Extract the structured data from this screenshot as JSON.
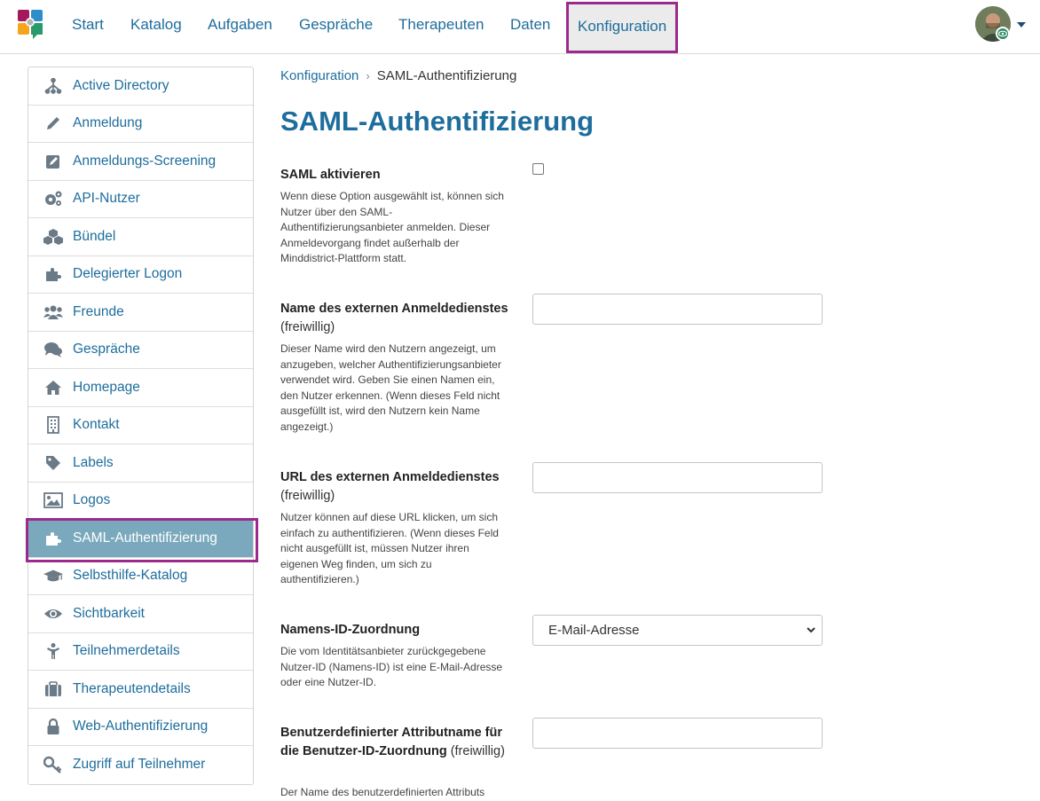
{
  "colors": {
    "primary": "#1e6d9c",
    "active_border": "#9c2a8c",
    "sidebar_active_bg": "#7aa9bd"
  },
  "nav": {
    "items": [
      {
        "label": "Start"
      },
      {
        "label": "Katalog"
      },
      {
        "label": "Aufgaben"
      },
      {
        "label": "Gespräche"
      },
      {
        "label": "Therapeuten"
      },
      {
        "label": "Daten"
      },
      {
        "label": "Konfiguration",
        "active": true
      }
    ]
  },
  "sidebar": {
    "items": [
      {
        "label": "Active Directory",
        "icon": "sitemap-icon"
      },
      {
        "label": "Anmeldung",
        "icon": "pencil-icon"
      },
      {
        "label": "Anmeldungs-Screening",
        "icon": "edit-square-icon"
      },
      {
        "label": "API-Nutzer",
        "icon": "gears-icon"
      },
      {
        "label": "Bündel",
        "icon": "cubes-icon"
      },
      {
        "label": "Delegierter Logon",
        "icon": "puzzle-icon"
      },
      {
        "label": "Freunde",
        "icon": "users-icon"
      },
      {
        "label": "Gespräche",
        "icon": "comments-icon"
      },
      {
        "label": "Homepage",
        "icon": "home-icon"
      },
      {
        "label": "Kontakt",
        "icon": "building-icon"
      },
      {
        "label": "Labels",
        "icon": "tag-icon"
      },
      {
        "label": "Logos",
        "icon": "image-icon"
      },
      {
        "label": "SAML-Authentifizierung",
        "icon": "puzzle-icon",
        "active": true
      },
      {
        "label": "Selbsthilfe-Katalog",
        "icon": "graduation-cap-icon"
      },
      {
        "label": "Sichtbarkeit",
        "icon": "eye-icon"
      },
      {
        "label": "Teilnehmerdetails",
        "icon": "child-icon"
      },
      {
        "label": "Therapeutendetails",
        "icon": "suitcase-icon"
      },
      {
        "label": "Web-Authentifizierung",
        "icon": "lock-icon"
      },
      {
        "label": "Zugriff auf Teilnehmer",
        "icon": "key-icon"
      }
    ]
  },
  "breadcrumb": {
    "parent": "Konfiguration",
    "separator": "›",
    "current": "SAML-Authentifizierung"
  },
  "page": {
    "title": "SAML-Authentifizierung"
  },
  "form": {
    "saml_enable": {
      "label": "SAML aktivieren",
      "help": "Wenn diese Option ausgewählt ist, können sich Nutzer über den SAML-Authentifizierungsanbieter anmelden. Dieser Anmeldevorgang findet außerhalb der Minddistrict-Plattform statt.",
      "checked": false
    },
    "service_name": {
      "label": "Name des externen Anmeldedienstes",
      "optional": "(freiwillig)",
      "help": "Dieser Name wird den Nutzern angezeigt, um anzugeben, welcher Authentifizierungsanbieter verwendet wird. Geben Sie einen Namen ein, den Nutzer erkennen. (Wenn dieses Feld nicht ausgefüllt ist, wird den Nutzern kein Name angezeigt.)",
      "value": ""
    },
    "service_url": {
      "label": "URL des externen Anmeldedienstes",
      "optional": "(freiwillig)",
      "help": "Nutzer können auf diese URL klicken, um sich einfach zu authentifizieren. (Wenn dieses Feld nicht ausgefüllt ist, müssen Nutzer ihren eigenen Weg finden, um sich zu authentifizieren.)",
      "value": ""
    },
    "name_id": {
      "label": "Namens-ID-Zuordnung",
      "help": "Die vom Identitätsanbieter zurückgegebene Nutzer-ID (Namens-ID) ist eine E-Mail-Adresse oder eine Nutzer-ID.",
      "selected": "E-Mail-Adresse"
    },
    "custom_attr": {
      "label": "Benutzerdefinierter Attributname für die Benutzer-ID-Zuordnung",
      "optional": "(freiwillig)",
      "help": "Der Name des benutzerdefinierten Attributs",
      "value": ""
    }
  }
}
